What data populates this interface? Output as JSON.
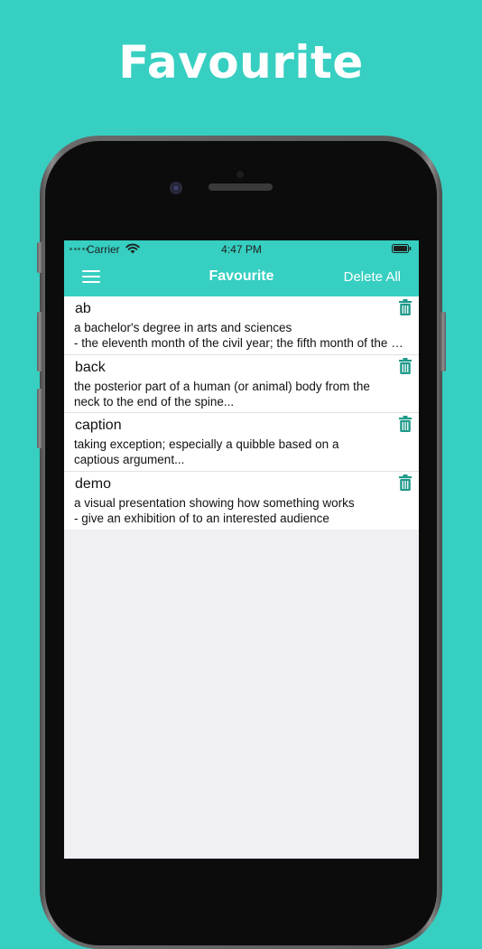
{
  "page": {
    "banner_title": "Favourite"
  },
  "status_bar": {
    "carrier": "Carrier",
    "time": "4:47 PM"
  },
  "nav": {
    "title": "Favourite",
    "delete_all_label": "Delete All",
    "menu_icon": "hamburger-menu-icon"
  },
  "favourites": [
    {
      "word": "ab",
      "lines": [
        "a bachelor's degree in arts and sciences",
        "- the eleventh month of the civil year; the fifth month of the ecclesiastical year"
      ]
    },
    {
      "word": "back",
      "lines": [
        "the posterior part of a human (or animal) body from the",
        "neck to the end of the spine..."
      ]
    },
    {
      "word": "caption",
      "lines": [
        "taking exception; especially a quibble based on a",
        "captious argument..."
      ]
    },
    {
      "word": "demo",
      "lines": [
        "a visual presentation showing how something works",
        "- give an exhibition of to an interested audience"
      ]
    }
  ],
  "colors": {
    "accent": "#36cfc1",
    "trash_icon": "#1f9a8a",
    "list_background": "#efeff4"
  },
  "icons": {
    "row_action": "trash-icon"
  }
}
